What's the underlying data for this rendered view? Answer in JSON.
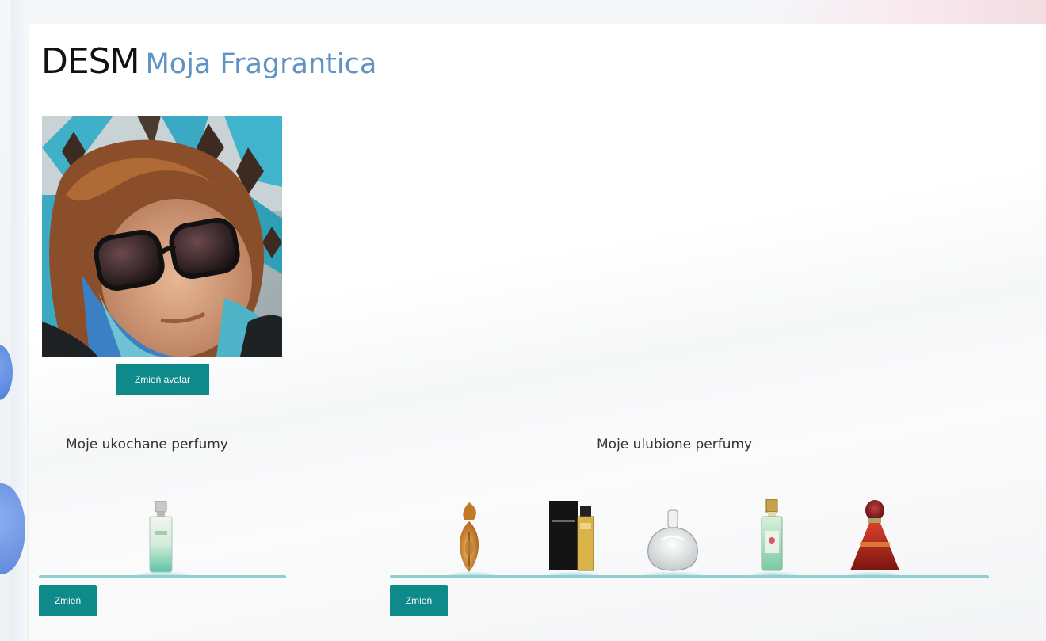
{
  "header": {
    "username": "DESM",
    "subtitle": "Moja Fragrantica"
  },
  "profile": {
    "change_avatar_label": "Zmień avatar"
  },
  "loved_perfumes": {
    "title": "Moje ukochane perfumy",
    "change_label": "Zmień",
    "items": [
      {
        "icon": "perfume-bottle-green-icon"
      }
    ]
  },
  "favorite_perfumes": {
    "title": "Moje ulubione perfumy",
    "change_label": "Zmień",
    "items": [
      {
        "icon": "perfume-bottle-amber-icon"
      },
      {
        "icon": "perfume-bottle-boxed-icon"
      },
      {
        "icon": "perfume-bottle-clear-icon"
      },
      {
        "icon": "perfume-bottle-green-tall-icon"
      },
      {
        "icon": "perfume-bottle-red-icon"
      }
    ]
  },
  "colors": {
    "accent": "#0e8a8a",
    "subtitle": "#5f93c6",
    "shelf": "#8fcfd0"
  }
}
